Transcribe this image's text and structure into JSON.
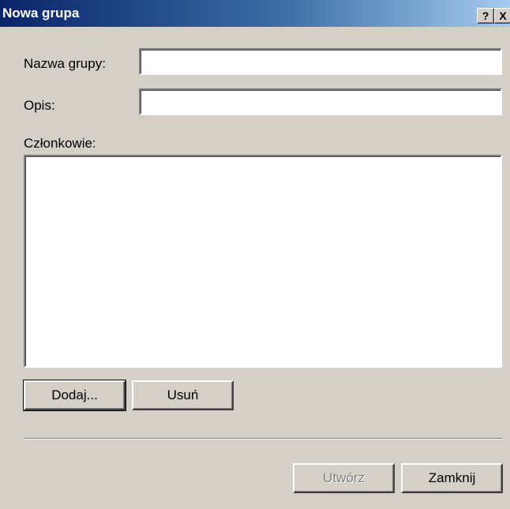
{
  "window": {
    "title": "Nowa grupa",
    "help_glyph": "?",
    "close_glyph": "X"
  },
  "form": {
    "name_label": "Nazwa grupy:",
    "name_value": "",
    "description_label": "Opis:",
    "description_value": "",
    "members_label": "Członkowie:",
    "members": []
  },
  "buttons": {
    "add": "Dodaj...",
    "remove": "Usuń",
    "create": "Utwórz",
    "close": "Zamknij"
  },
  "colors": {
    "titlebar_start": "#0a246a",
    "titlebar_end": "#a6caf0",
    "dialog_face": "#d4d0c8"
  }
}
